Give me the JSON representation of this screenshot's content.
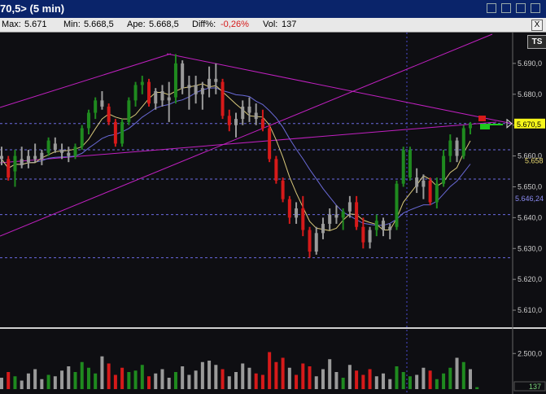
{
  "window": {
    "title": "70,5> (5 min)"
  },
  "infobar": {
    "max_label": "Max:",
    "max_value": "5.671",
    "min_label": "Min:",
    "min_value": "5.668,5",
    "open_label": "Ape:",
    "open_value": "5.668,5",
    "diff_label": "Diff%:",
    "diff_value": "-0,26%",
    "vol_label": "Vol:",
    "vol_value": "137"
  },
  "toolbar": {
    "ts_label": "TS",
    "close_label": "X"
  },
  "price_axis": {
    "ticks": [
      "5.690,0",
      "5.680,0",
      "5.670,0",
      "5.660,0",
      "5.650,0",
      "5.640,0",
      "5.630,0",
      "5.620,0",
      "5.610,0"
    ],
    "last_price_label": "5.670,5",
    "ma_fast_label": "5.658",
    "ma_slow_label": "5.646,24"
  },
  "volume_axis": {
    "ticks": [
      "2.500,0"
    ],
    "last_volume_label": "137"
  },
  "colors": {
    "up": "#1f8a1f",
    "down": "#d61a1a",
    "neutral": "#9a9a9a",
    "ma_fast": "#d8c87a",
    "ma_slow": "#6a6ad8",
    "trendline": "#c020c0",
    "hline": "#6a6ae0",
    "last_price_bg": "#f5f51a"
  },
  "chart_data": {
    "type": "ohlc-candlestick",
    "interval": "5 min",
    "ylim": [
      5605,
      5700
    ],
    "horizontal_levels": [
      5670.5,
      5662,
      5652.5,
      5641,
      5627
    ],
    "bars": [
      {
        "o": 5660,
        "h": 5663,
        "l": 5657,
        "c": 5659,
        "d": "n"
      },
      {
        "o": 5659,
        "h": 5660,
        "l": 5652,
        "c": 5653,
        "d": "d"
      },
      {
        "o": 5655,
        "h": 5662,
        "l": 5650,
        "c": 5660,
        "d": "u"
      },
      {
        "o": 5659,
        "h": 5663,
        "l": 5656,
        "c": 5657,
        "d": "n"
      },
      {
        "o": 5658,
        "h": 5662,
        "l": 5656,
        "c": 5660,
        "d": "n"
      },
      {
        "o": 5660,
        "h": 5664,
        "l": 5658,
        "c": 5659,
        "d": "n"
      },
      {
        "o": 5659,
        "h": 5662,
        "l": 5657,
        "c": 5661,
        "d": "n"
      },
      {
        "o": 5661,
        "h": 5666,
        "l": 5660,
        "c": 5665,
        "d": "u"
      },
      {
        "o": 5664,
        "h": 5666,
        "l": 5661,
        "c": 5662,
        "d": "n"
      },
      {
        "o": 5662,
        "h": 5664,
        "l": 5659,
        "c": 5661,
        "d": "n"
      },
      {
        "o": 5661,
        "h": 5663,
        "l": 5658,
        "c": 5660,
        "d": "n"
      },
      {
        "o": 5660,
        "h": 5664,
        "l": 5659,
        "c": 5663,
        "d": "u"
      },
      {
        "o": 5663,
        "h": 5670,
        "l": 5662,
        "c": 5669,
        "d": "u"
      },
      {
        "o": 5669,
        "h": 5675,
        "l": 5667,
        "c": 5674,
        "d": "u"
      },
      {
        "o": 5674,
        "h": 5679,
        "l": 5672,
        "c": 5678,
        "d": "u"
      },
      {
        "o": 5678,
        "h": 5681,
        "l": 5675,
        "c": 5676,
        "d": "n"
      },
      {
        "o": 5676,
        "h": 5677,
        "l": 5670,
        "c": 5671,
        "d": "d"
      },
      {
        "o": 5671,
        "h": 5672,
        "l": 5663,
        "c": 5664,
        "d": "d"
      },
      {
        "o": 5664,
        "h": 5672,
        "l": 5663,
        "c": 5671,
        "d": "u"
      },
      {
        "o": 5671,
        "h": 5679,
        "l": 5670,
        "c": 5678,
        "d": "u"
      },
      {
        "o": 5678,
        "h": 5684,
        "l": 5676,
        "c": 5683,
        "d": "u"
      },
      {
        "o": 5683,
        "h": 5686,
        "l": 5680,
        "c": 5684,
        "d": "u"
      },
      {
        "o": 5684,
        "h": 5685,
        "l": 5676,
        "c": 5677,
        "d": "d"
      },
      {
        "o": 5677,
        "h": 5682,
        "l": 5675,
        "c": 5681,
        "d": "n"
      },
      {
        "o": 5681,
        "h": 5683,
        "l": 5676,
        "c": 5678,
        "d": "n"
      },
      {
        "o": 5678,
        "h": 5684,
        "l": 5671,
        "c": 5679,
        "d": "n"
      },
      {
        "o": 5679,
        "h": 5693,
        "l": 5677,
        "c": 5690,
        "d": "u"
      },
      {
        "o": 5690,
        "h": 5691,
        "l": 5680,
        "c": 5682,
        "d": "n"
      },
      {
        "o": 5682,
        "h": 5686,
        "l": 5675,
        "c": 5683,
        "d": "n"
      },
      {
        "o": 5683,
        "h": 5686,
        "l": 5677,
        "c": 5680,
        "d": "n"
      },
      {
        "o": 5680,
        "h": 5684,
        "l": 5675,
        "c": 5682,
        "d": "n"
      },
      {
        "o": 5682,
        "h": 5689,
        "l": 5679,
        "c": 5685,
        "d": "n"
      },
      {
        "o": 5685,
        "h": 5690,
        "l": 5680,
        "c": 5684,
        "d": "n"
      },
      {
        "o": 5684,
        "h": 5685,
        "l": 5672,
        "c": 5673,
        "d": "d"
      },
      {
        "o": 5673,
        "h": 5675,
        "l": 5668,
        "c": 5670,
        "d": "d"
      },
      {
        "o": 5670,
        "h": 5674,
        "l": 5666,
        "c": 5672,
        "d": "n"
      },
      {
        "o": 5672,
        "h": 5678,
        "l": 5670,
        "c": 5676,
        "d": "n"
      },
      {
        "o": 5676,
        "h": 5679,
        "l": 5671,
        "c": 5674,
        "d": "n"
      },
      {
        "o": 5674,
        "h": 5677,
        "l": 5670,
        "c": 5672,
        "d": "n"
      },
      {
        "o": 5672,
        "h": 5675,
        "l": 5668,
        "c": 5669,
        "d": "d"
      },
      {
        "o": 5669,
        "h": 5670,
        "l": 5658,
        "c": 5659,
        "d": "d"
      },
      {
        "o": 5659,
        "h": 5660,
        "l": 5651,
        "c": 5652,
        "d": "d"
      },
      {
        "o": 5652,
        "h": 5653,
        "l": 5645,
        "c": 5646,
        "d": "d"
      },
      {
        "o": 5646,
        "h": 5647,
        "l": 5638,
        "c": 5640,
        "d": "d"
      },
      {
        "o": 5640,
        "h": 5645,
        "l": 5638,
        "c": 5643,
        "d": "n"
      },
      {
        "o": 5643,
        "h": 5647,
        "l": 5634,
        "c": 5636,
        "d": "d"
      },
      {
        "o": 5636,
        "h": 5637,
        "l": 5627,
        "c": 5629,
        "d": "d"
      },
      {
        "o": 5629,
        "h": 5637,
        "l": 5628,
        "c": 5635,
        "d": "n"
      },
      {
        "o": 5635,
        "h": 5640,
        "l": 5633,
        "c": 5638,
        "d": "n"
      },
      {
        "o": 5638,
        "h": 5643,
        "l": 5636,
        "c": 5641,
        "d": "n"
      },
      {
        "o": 5641,
        "h": 5644,
        "l": 5638,
        "c": 5640,
        "d": "n"
      },
      {
        "o": 5640,
        "h": 5643,
        "l": 5636,
        "c": 5642,
        "d": "u"
      },
      {
        "o": 5642,
        "h": 5647,
        "l": 5640,
        "c": 5645,
        "d": "n"
      },
      {
        "o": 5645,
        "h": 5647,
        "l": 5636,
        "c": 5637,
        "d": "d"
      },
      {
        "o": 5637,
        "h": 5640,
        "l": 5630,
        "c": 5632,
        "d": "d"
      },
      {
        "o": 5632,
        "h": 5637,
        "l": 5630,
        "c": 5636,
        "d": "n"
      },
      {
        "o": 5636,
        "h": 5641,
        "l": 5634,
        "c": 5639,
        "d": "u"
      },
      {
        "o": 5639,
        "h": 5640,
        "l": 5634,
        "c": 5636,
        "d": "n"
      },
      {
        "o": 5636,
        "h": 5638,
        "l": 5633,
        "c": 5637,
        "d": "n"
      },
      {
        "o": 5637,
        "h": 5652,
        "l": 5636,
        "c": 5651,
        "d": "u"
      },
      {
        "o": 5651,
        "h": 5663,
        "l": 5650,
        "c": 5662,
        "d": "u"
      },
      {
        "o": 5662,
        "h": 5663,
        "l": 5652,
        "c": 5653,
        "d": "u"
      },
      {
        "o": 5653,
        "h": 5656,
        "l": 5648,
        "c": 5650,
        "d": "n"
      },
      {
        "o": 5650,
        "h": 5654,
        "l": 5646,
        "c": 5652,
        "d": "n"
      },
      {
        "o": 5652,
        "h": 5653,
        "l": 5644,
        "c": 5645,
        "d": "d"
      },
      {
        "o": 5645,
        "h": 5653,
        "l": 5643,
        "c": 5651,
        "d": "u"
      },
      {
        "o": 5651,
        "h": 5662,
        "l": 5650,
        "c": 5660,
        "d": "u"
      },
      {
        "o": 5660,
        "h": 5667,
        "l": 5658,
        "c": 5665,
        "d": "u"
      },
      {
        "o": 5665,
        "h": 5666,
        "l": 5658,
        "c": 5660,
        "d": "n"
      },
      {
        "o": 5660,
        "h": 5670,
        "l": 5659,
        "c": 5669,
        "d": "u"
      },
      {
        "o": 5669,
        "h": 5671,
        "l": 5667,
        "c": 5670.5,
        "d": "u"
      }
    ],
    "ma_fast_label": "5.658",
    "ma_slow_label": "5.646,24",
    "volume": {
      "ylim": [
        0,
        4000
      ],
      "values": [
        800,
        1200,
        900,
        600,
        1100,
        1400,
        700,
        1000,
        900,
        1300,
        1600,
        1200,
        1900,
        1500,
        1100,
        2300,
        1800,
        1000,
        1500,
        1200,
        1300,
        1700,
        900,
        1100,
        1400,
        800,
        1200,
        1600,
        1000,
        1300,
        1900,
        2000,
        1700,
        1400,
        900,
        1200,
        1800,
        1500,
        1100,
        1000,
        2600,
        1900,
        2200,
        1500,
        1000,
        1800,
        1600,
        900,
        1400,
        2100,
        1200,
        800,
        1700,
        1300,
        1000,
        1400,
        900,
        1100,
        700,
        1600,
        1200,
        900,
        1000,
        1500,
        1300,
        700,
        1100,
        1500,
        2200,
        1900,
        1400,
        137
      ],
      "dirs": "ndunnnnunnnuuuunddduuudnnnunnnnnndnnnndddddndddnnnnundddnnnuuunnduuununu"
    }
  }
}
